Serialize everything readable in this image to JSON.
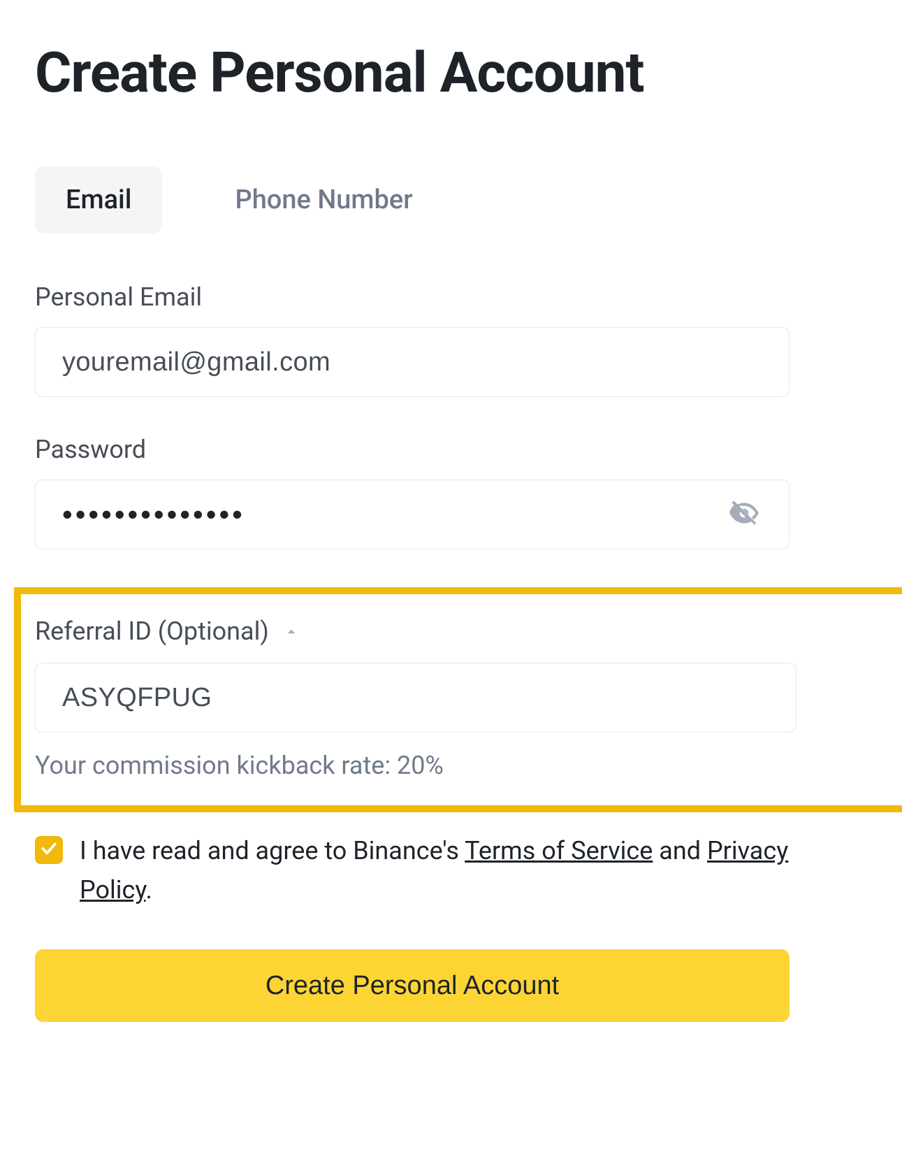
{
  "title": "Create Personal Account",
  "tabs": {
    "email": "Email",
    "phone": "Phone Number"
  },
  "email": {
    "label": "Personal Email",
    "value": "youremail@gmail.com"
  },
  "password": {
    "label": "Password",
    "value": "••••••••••••••"
  },
  "referral": {
    "label": "Referral ID (Optional)",
    "value": "ASYQFPUG",
    "kickback": "Your commission kickback rate: 20%"
  },
  "agree": {
    "prefix": "I have read and agree to Binance's ",
    "terms": "Terms of Service",
    "mid": " and ",
    "privacy": "Privacy Policy",
    "suffix": "."
  },
  "submit": "Create Personal Account"
}
